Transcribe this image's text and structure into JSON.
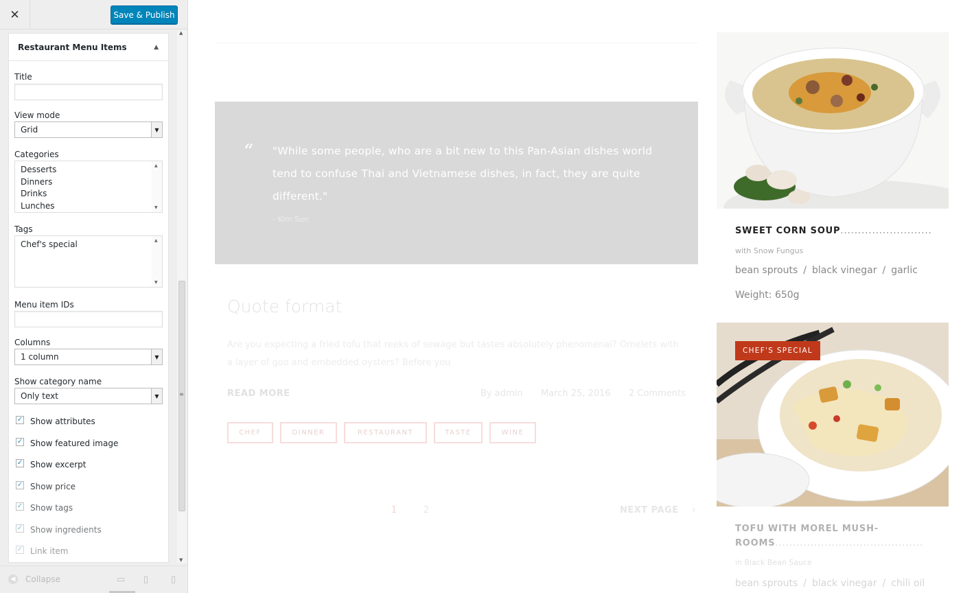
{
  "toolbar": {
    "close_icon": "close-icon",
    "save_label": "Save & Publish",
    "accent_color": "#0085ba"
  },
  "widget": {
    "title": "Restaurant Menu Items",
    "fields": {
      "title_label": "Title",
      "title_value": "",
      "view_mode_label": "View mode",
      "view_mode_value": "Grid",
      "categories_label": "Categories",
      "categories": [
        "Desserts",
        "Dinners",
        "Drinks",
        "Lunches"
      ],
      "tags_label": "Tags",
      "tags": [
        "Chef's special"
      ],
      "ids_label": "Menu item IDs",
      "ids_value": "",
      "columns_label": "Columns",
      "columns_value": "1 column",
      "show_category_label": "Show category name",
      "show_category_value": "Only text"
    },
    "checkboxes": [
      {
        "label": "Show attributes",
        "checked": true
      },
      {
        "label": "Show featured image",
        "checked": true
      },
      {
        "label": "Show excerpt",
        "checked": true
      },
      {
        "label": "Show price",
        "checked": true
      },
      {
        "label": "Show tags",
        "checked": true
      },
      {
        "label": "Show ingredients",
        "checked": true
      },
      {
        "label": "Link item",
        "checked": true
      }
    ]
  },
  "footer": {
    "collapse_label": "Collapse",
    "devices": [
      "desktop-icon",
      "tablet-icon",
      "mobile-icon"
    ]
  },
  "preview": {
    "quote": {
      "text": "\"While some people, who are a bit new to this Pan-Asian dishes world tend to confuse Thai and Vietnamese dishes, in fact, they are quite different.\"",
      "author": "- Kim Sun"
    },
    "post": {
      "title": "Quote format",
      "excerpt": "Are you expecting a fried tofu that reeks of sewage but tastes absolutely phenomenal? Omelets with a layer of goo and embedded oysters? Before you",
      "read_more": "READ MORE",
      "author": "By admin",
      "date": "March 25, 2016",
      "comments": "2 Comments",
      "tags": [
        "CHEF",
        "DINNER",
        "RESTAURANT",
        "TASTE",
        "WINE"
      ]
    },
    "pagination": {
      "page1": "1",
      "page2": "2",
      "next": "NEXT PAGE",
      "next_arrow": "›"
    },
    "menu_items": [
      {
        "name": "SWEET CORN SOUP",
        "dots": "..........................",
        "subtitle": "with Snow Fungus",
        "ingredients": [
          "bean sprouts",
          "black vinegar",
          "garlic"
        ],
        "separator": "/",
        "weight": "Weight: 650g"
      },
      {
        "badge": "CHEF'S SPECIAL",
        "name_line1": "TOFU WITH MOREL MUSH-",
        "name_line2": "ROOMS",
        "dots": "..........................................",
        "subtitle": "in Black Bean Sauce",
        "ingredients": [
          "bean sprouts",
          "black vinegar",
          "chili oil"
        ],
        "separator": "/"
      }
    ],
    "badge_color": "#c0391b"
  }
}
